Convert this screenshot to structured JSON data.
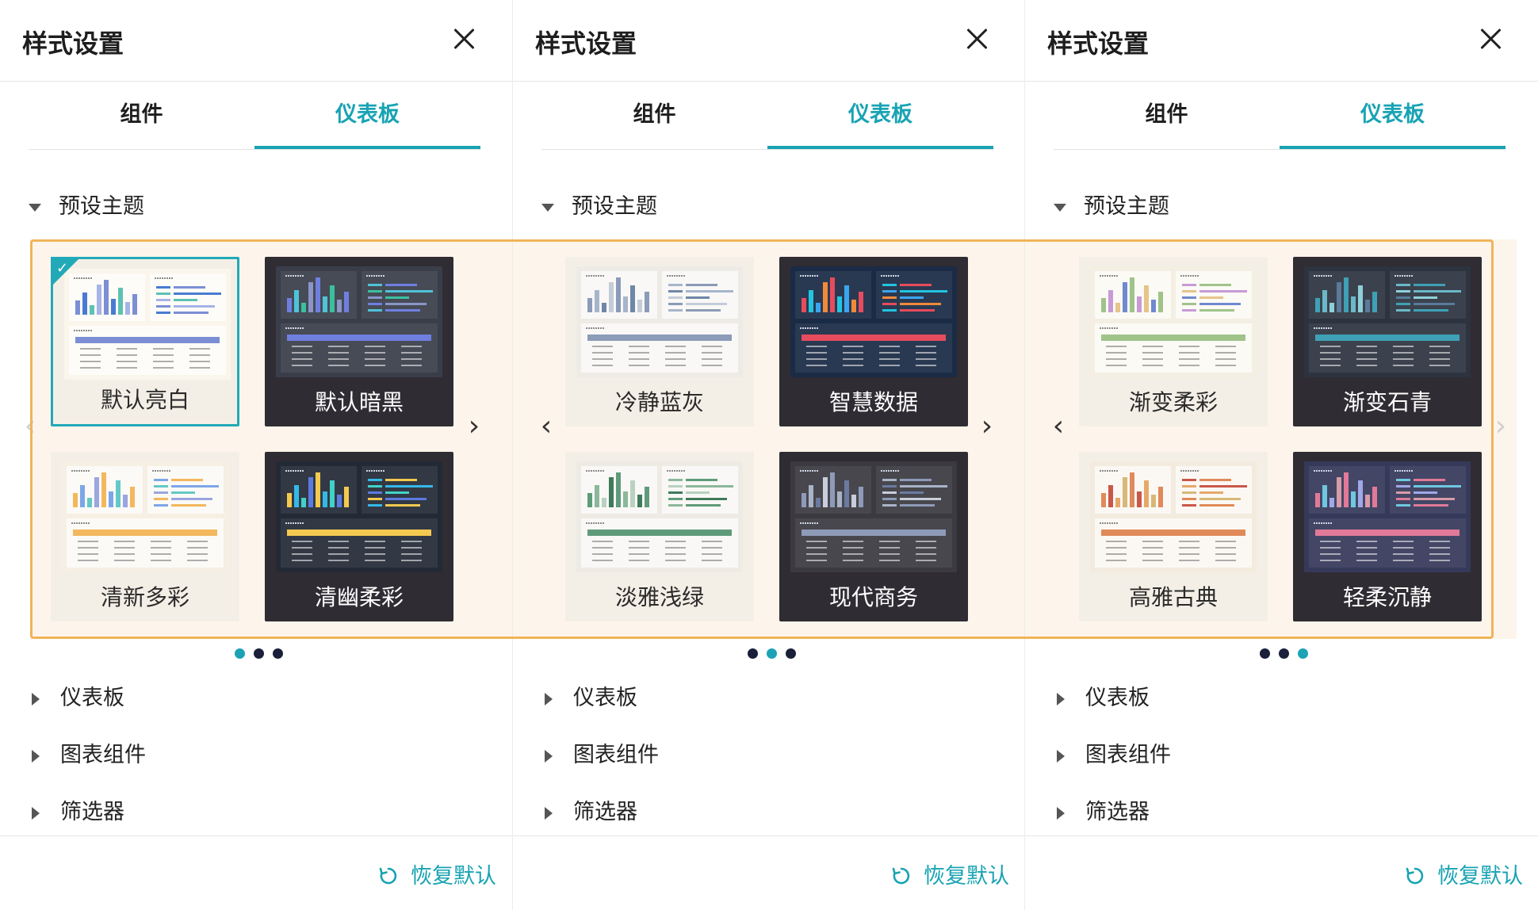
{
  "panels": [
    {
      "title": "样式设置",
      "tabs": [
        "组件",
        "仪表板"
      ],
      "active_tab": 1,
      "preset_section": "预设主题",
      "themes": [
        {
          "name": "默认亮白",
          "style": "light",
          "selected": true
        },
        {
          "name": "默认暗黑",
          "style": "dark",
          "selected": false
        },
        {
          "name": "清新多彩",
          "style": "light",
          "selected": false
        },
        {
          "name": "清幽柔彩",
          "style": "dark",
          "selected": false
        }
      ],
      "page_index": 0,
      "sections": [
        "仪表板",
        "图表组件",
        "筛选器"
      ],
      "restore_label": "恢复默认"
    },
    {
      "title": "样式设置",
      "tabs": [
        "组件",
        "仪表板"
      ],
      "active_tab": 1,
      "preset_section": "预设主题",
      "themes": [
        {
          "name": "冷静蓝灰",
          "style": "light",
          "selected": false
        },
        {
          "name": "智慧数据",
          "style": "dark",
          "selected": false
        },
        {
          "name": "淡雅浅绿",
          "style": "light",
          "selected": false
        },
        {
          "name": "现代商务",
          "style": "dark",
          "selected": false
        }
      ],
      "page_index": 1,
      "sections": [
        "仪表板",
        "图表组件",
        "筛选器"
      ],
      "restore_label": "恢复默认"
    },
    {
      "title": "样式设置",
      "tabs": [
        "组件",
        "仪表板"
      ],
      "active_tab": 1,
      "preset_section": "预设主题",
      "themes": [
        {
          "name": "渐变柔彩",
          "style": "light",
          "selected": false
        },
        {
          "name": "渐变石青",
          "style": "dark",
          "selected": false
        },
        {
          "name": "高雅古典",
          "style": "light",
          "selected": false
        },
        {
          "name": "轻柔沉静",
          "style": "dark",
          "selected": false
        }
      ],
      "page_index": 2,
      "sections": [
        "仪表板",
        "图表组件",
        "筛选器"
      ],
      "restore_label": "恢复默认"
    }
  ],
  "page_count": 3,
  "colors": {
    "accent": "#18a3b3",
    "highlight_border": "#f0b45a",
    "carousel_bg": "#fdf5eb",
    "light_card": "#f4efe6",
    "dark_card": "#302c33",
    "dot_inactive": "#1a1f3a"
  },
  "icons": {
    "close": "close-icon",
    "collapse": "caret-down-icon",
    "expand": "caret-right-icon",
    "prev": "chevron-left-icon",
    "next": "chevron-right-icon",
    "restore": "refresh-icon",
    "check": "checkmark-icon"
  },
  "thumb_palettes": [
    [
      "#fbf6ec",
      "#7c8fd4",
      "#4a7bd0",
      "#5cc2b3",
      "#a6b3e8"
    ],
    [
      "#3a3e4a",
      "#6f7fe0",
      "#4fc3d8",
      "#3bbf9f",
      "#8a95c8"
    ],
    [
      "#f6efe4",
      "#f3b85e",
      "#7da6e8",
      "#64c8c8",
      "#9aa6e0"
    ],
    [
      "#232a36",
      "#f3c94f",
      "#34b8e8",
      "#40d2c8",
      "#5b7be0"
    ],
    [
      "#eeebe6",
      "#8b9bb8",
      "#a7b5cc",
      "#6e87a8",
      "#c4ccd8"
    ],
    [
      "#1a2b45",
      "#e64c5d",
      "#22c5e0",
      "#3aa6f0",
      "#f08a3a"
    ],
    [
      "#eeebe4",
      "#5f9b7a",
      "#8bb89a",
      "#b8d2bf",
      "#3f7a5a"
    ],
    [
      "#3b3a40",
      "#8d9bb8",
      "#a9b3c8",
      "#6c7aa0",
      "#c8cedb"
    ],
    [
      "#f4efe3",
      "#a0c38a",
      "#c89ad6",
      "#e6c48a",
      "#6f8ad0"
    ],
    [
      "#2d3440",
      "#3fa0b6",
      "#6ab8c8",
      "#8ed0d8",
      "#5a7a9a"
    ],
    [
      "#f2ebde",
      "#e08a5a",
      "#c9584a",
      "#e6a86a",
      "#d8b878"
    ],
    [
      "#35395a",
      "#e07a98",
      "#6fc7e0",
      "#9fa8e8",
      "#d89aa8"
    ]
  ]
}
